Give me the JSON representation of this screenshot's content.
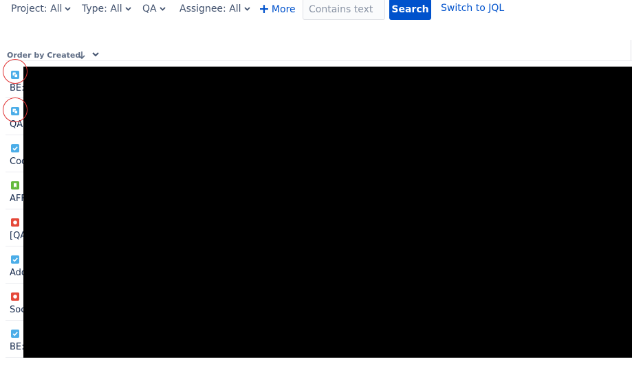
{
  "filters": {
    "project": "Project: All",
    "type": "Type: All",
    "qa": "QA",
    "assignee": "Assignee: All",
    "more": "More"
  },
  "search": {
    "placeholder": "Contains text",
    "button_label": "Search"
  },
  "switch_jql": "Switch to JQL",
  "order": {
    "label": "Order by Created",
    "direction": "descending"
  },
  "issues": [
    {
      "type": "subtask",
      "text": "BE:"
    },
    {
      "type": "subtask",
      "text": "QA"
    },
    {
      "type": "task",
      "text": "Coo"
    },
    {
      "type": "story",
      "text": "AFF"
    },
    {
      "type": "bug",
      "text": "[QA"
    },
    {
      "type": "task",
      "text": "Add"
    },
    {
      "type": "bug",
      "text": "Soc"
    },
    {
      "type": "task",
      "text": "BE:"
    }
  ],
  "icon_colors": {
    "subtask": "#4bade8",
    "task": "#4bade8",
    "story": "#63ba3c",
    "bug": "#e5493a",
    "link": "#0052cc",
    "annotation": "#e03131",
    "redaction": "#000000"
  }
}
